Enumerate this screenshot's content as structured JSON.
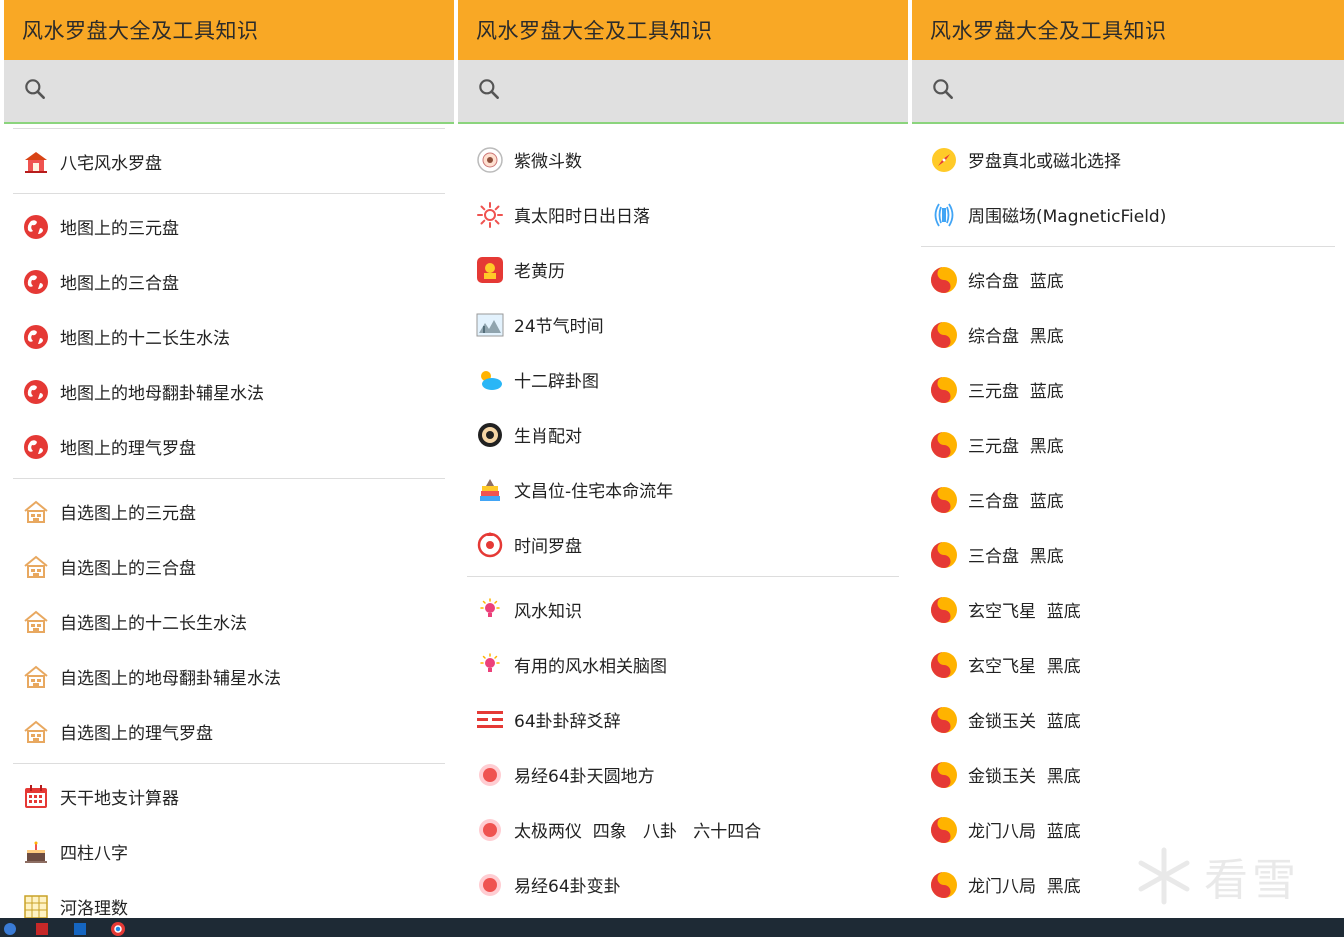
{
  "panels": [
    {
      "title": "风水罗盘大全及工具知识",
      "search_placeholder": "",
      "items": [
        {
          "type": "divider"
        },
        {
          "label": "八宅风水罗盘",
          "icon": "house-red-icon"
        },
        {
          "type": "divider"
        },
        {
          "label": "地图上的三元盘",
          "icon": "globe-icon"
        },
        {
          "label": "地图上的三合盘",
          "icon": "globe-icon"
        },
        {
          "label": "地图上的十二长生水法",
          "icon": "globe-icon"
        },
        {
          "label": "地图上的地母翻卦辅星水法",
          "icon": "globe-icon"
        },
        {
          "label": "地图上的理气罗盘",
          "icon": "globe-icon"
        },
        {
          "type": "divider"
        },
        {
          "label": "自选图上的三元盘",
          "icon": "house-outline-icon"
        },
        {
          "label": "自选图上的三合盘",
          "icon": "house-outline-icon"
        },
        {
          "label": "自选图上的十二长生水法",
          "icon": "house-outline-icon"
        },
        {
          "label": "自选图上的地母翻卦辅星水法",
          "icon": "house-outline-icon"
        },
        {
          "label": "自选图上的理气罗盘",
          "icon": "house-outline-icon"
        },
        {
          "type": "divider"
        },
        {
          "label": "天干地支计算器",
          "icon": "calendar-icon"
        },
        {
          "label": "四柱八字",
          "icon": "cake-icon"
        },
        {
          "label": "河洛理数",
          "icon": "grid-icon"
        }
      ]
    },
    {
      "title": "风水罗盘大全及工具知识",
      "search_placeholder": "",
      "items": [
        {
          "type": "gap"
        },
        {
          "label": "紫微斗数",
          "icon": "ziwei-icon"
        },
        {
          "label": "真太阳时日出日落",
          "icon": "sun-icon"
        },
        {
          "label": "老黄历",
          "icon": "almanac-icon"
        },
        {
          "label": "24节气时间",
          "icon": "landscape-icon"
        },
        {
          "label": "十二辟卦图",
          "icon": "weather-cloud-icon"
        },
        {
          "label": "生肖配对",
          "icon": "donut-icon"
        },
        {
          "label": "文昌位-住宅本命流年",
          "icon": "books-icon"
        },
        {
          "label": "时间罗盘",
          "icon": "time-compass-icon"
        },
        {
          "type": "divider"
        },
        {
          "label": "风水知识",
          "icon": "bulb-icon"
        },
        {
          "label": "有用的风水相关脑图",
          "icon": "bulb-icon"
        },
        {
          "label": "64卦卦辞爻辞",
          "icon": "trigram-icon"
        },
        {
          "label": "易经64卦天圆地方",
          "icon": "red-dot-icon"
        },
        {
          "label": "太极两仪  四象   八卦   六十四合",
          "icon": "red-dot-icon"
        },
        {
          "label": "易经64卦变卦",
          "icon": "red-dot-icon"
        }
      ]
    },
    {
      "title": "风水罗盘大全及工具知识",
      "search_placeholder": "",
      "items": [
        {
          "type": "gap"
        },
        {
          "label": "罗盘真北或磁北选择",
          "icon": "compass-icon"
        },
        {
          "label": "周围磁场(MagneticField)",
          "icon": "magnet-field-icon"
        },
        {
          "type": "divider"
        },
        {
          "label": "综合盘  蓝底",
          "icon": "yinyang-icon"
        },
        {
          "label": "综合盘  黑底",
          "icon": "yinyang-icon"
        },
        {
          "label": "三元盘  蓝底",
          "icon": "yinyang-icon"
        },
        {
          "label": "三元盘  黑底",
          "icon": "yinyang-icon"
        },
        {
          "label": "三合盘  蓝底",
          "icon": "yinyang-icon"
        },
        {
          "label": "三合盘  黑底",
          "icon": "yinyang-icon"
        },
        {
          "label": "玄空飞星  蓝底",
          "icon": "yinyang-icon"
        },
        {
          "label": "玄空飞星  黑底",
          "icon": "yinyang-icon"
        },
        {
          "label": "金锁玉关  蓝底",
          "icon": "yinyang-icon"
        },
        {
          "label": "金锁玉关  黑底",
          "icon": "yinyang-icon"
        },
        {
          "label": "龙门八局  蓝底",
          "icon": "yinyang-icon"
        },
        {
          "label": "龙门八局  黑底",
          "icon": "yinyang-icon"
        }
      ]
    }
  ],
  "watermark": {
    "text": "看雪"
  },
  "colors": {
    "appbar": "#f9a825",
    "search_bg": "#e0e0e0",
    "search_line": "#8bd47d",
    "taskbar": "#1e2a35"
  }
}
